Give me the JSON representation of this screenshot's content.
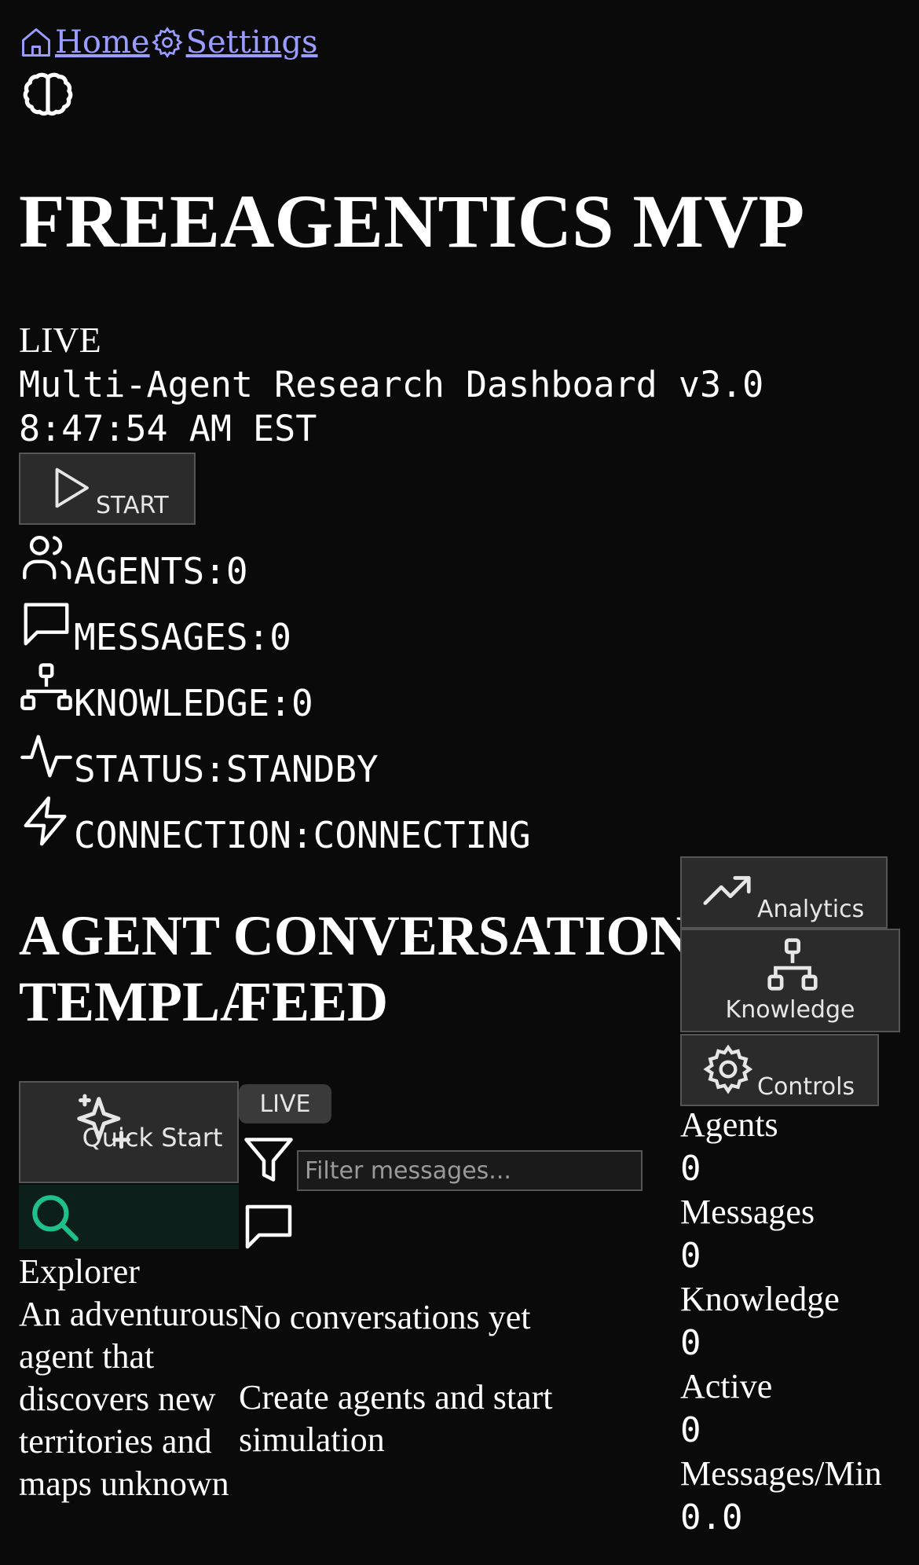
{
  "nav": {
    "home_label": "Home",
    "settings_label": "Settings",
    "link_color": "#9b9cff"
  },
  "header": {
    "title": "FREEAGENTICS MVP",
    "live_label": "LIVE",
    "subtitle": "Multi-Agent Research Dashboard v3.0",
    "clock": "8:47:54 AM EST"
  },
  "start_button": {
    "label": "START"
  },
  "stats": {
    "agents": "AGENTS:0",
    "messages": "MESSAGES:0",
    "knowledge": "KNOWLEDGE:0",
    "status": "STATUS:STANDBY",
    "connection": "CONNECTION:CONNECTING"
  },
  "sections": {
    "conversation_title": "AGENT CONVERSATION",
    "templates_title": "TEMPLATES",
    "feed_title": "FEED"
  },
  "templates": {
    "quick_start_label": "Quick Start",
    "explorer": {
      "name": "Explorer",
      "description": "An adventurous agent that discovers new territories and maps unknown",
      "accent_color": "#1fc08a"
    }
  },
  "feed": {
    "live_badge": "LIVE",
    "filter_placeholder": "Filter messages...",
    "filter_value": "",
    "empty_title": "No conversations yet",
    "empty_subtitle": "Create agents and start simulation"
  },
  "side_tabs": {
    "analytics": "Analytics",
    "knowledge": "Knowledge",
    "controls": "Controls"
  },
  "metrics": [
    {
      "label": "Agents",
      "value": "0"
    },
    {
      "label": "Messages",
      "value": "0"
    },
    {
      "label": "Knowledge",
      "value": "0"
    },
    {
      "label": "Active",
      "value": "0"
    },
    {
      "label": "Messages/Min",
      "value": "0.0"
    }
  ]
}
